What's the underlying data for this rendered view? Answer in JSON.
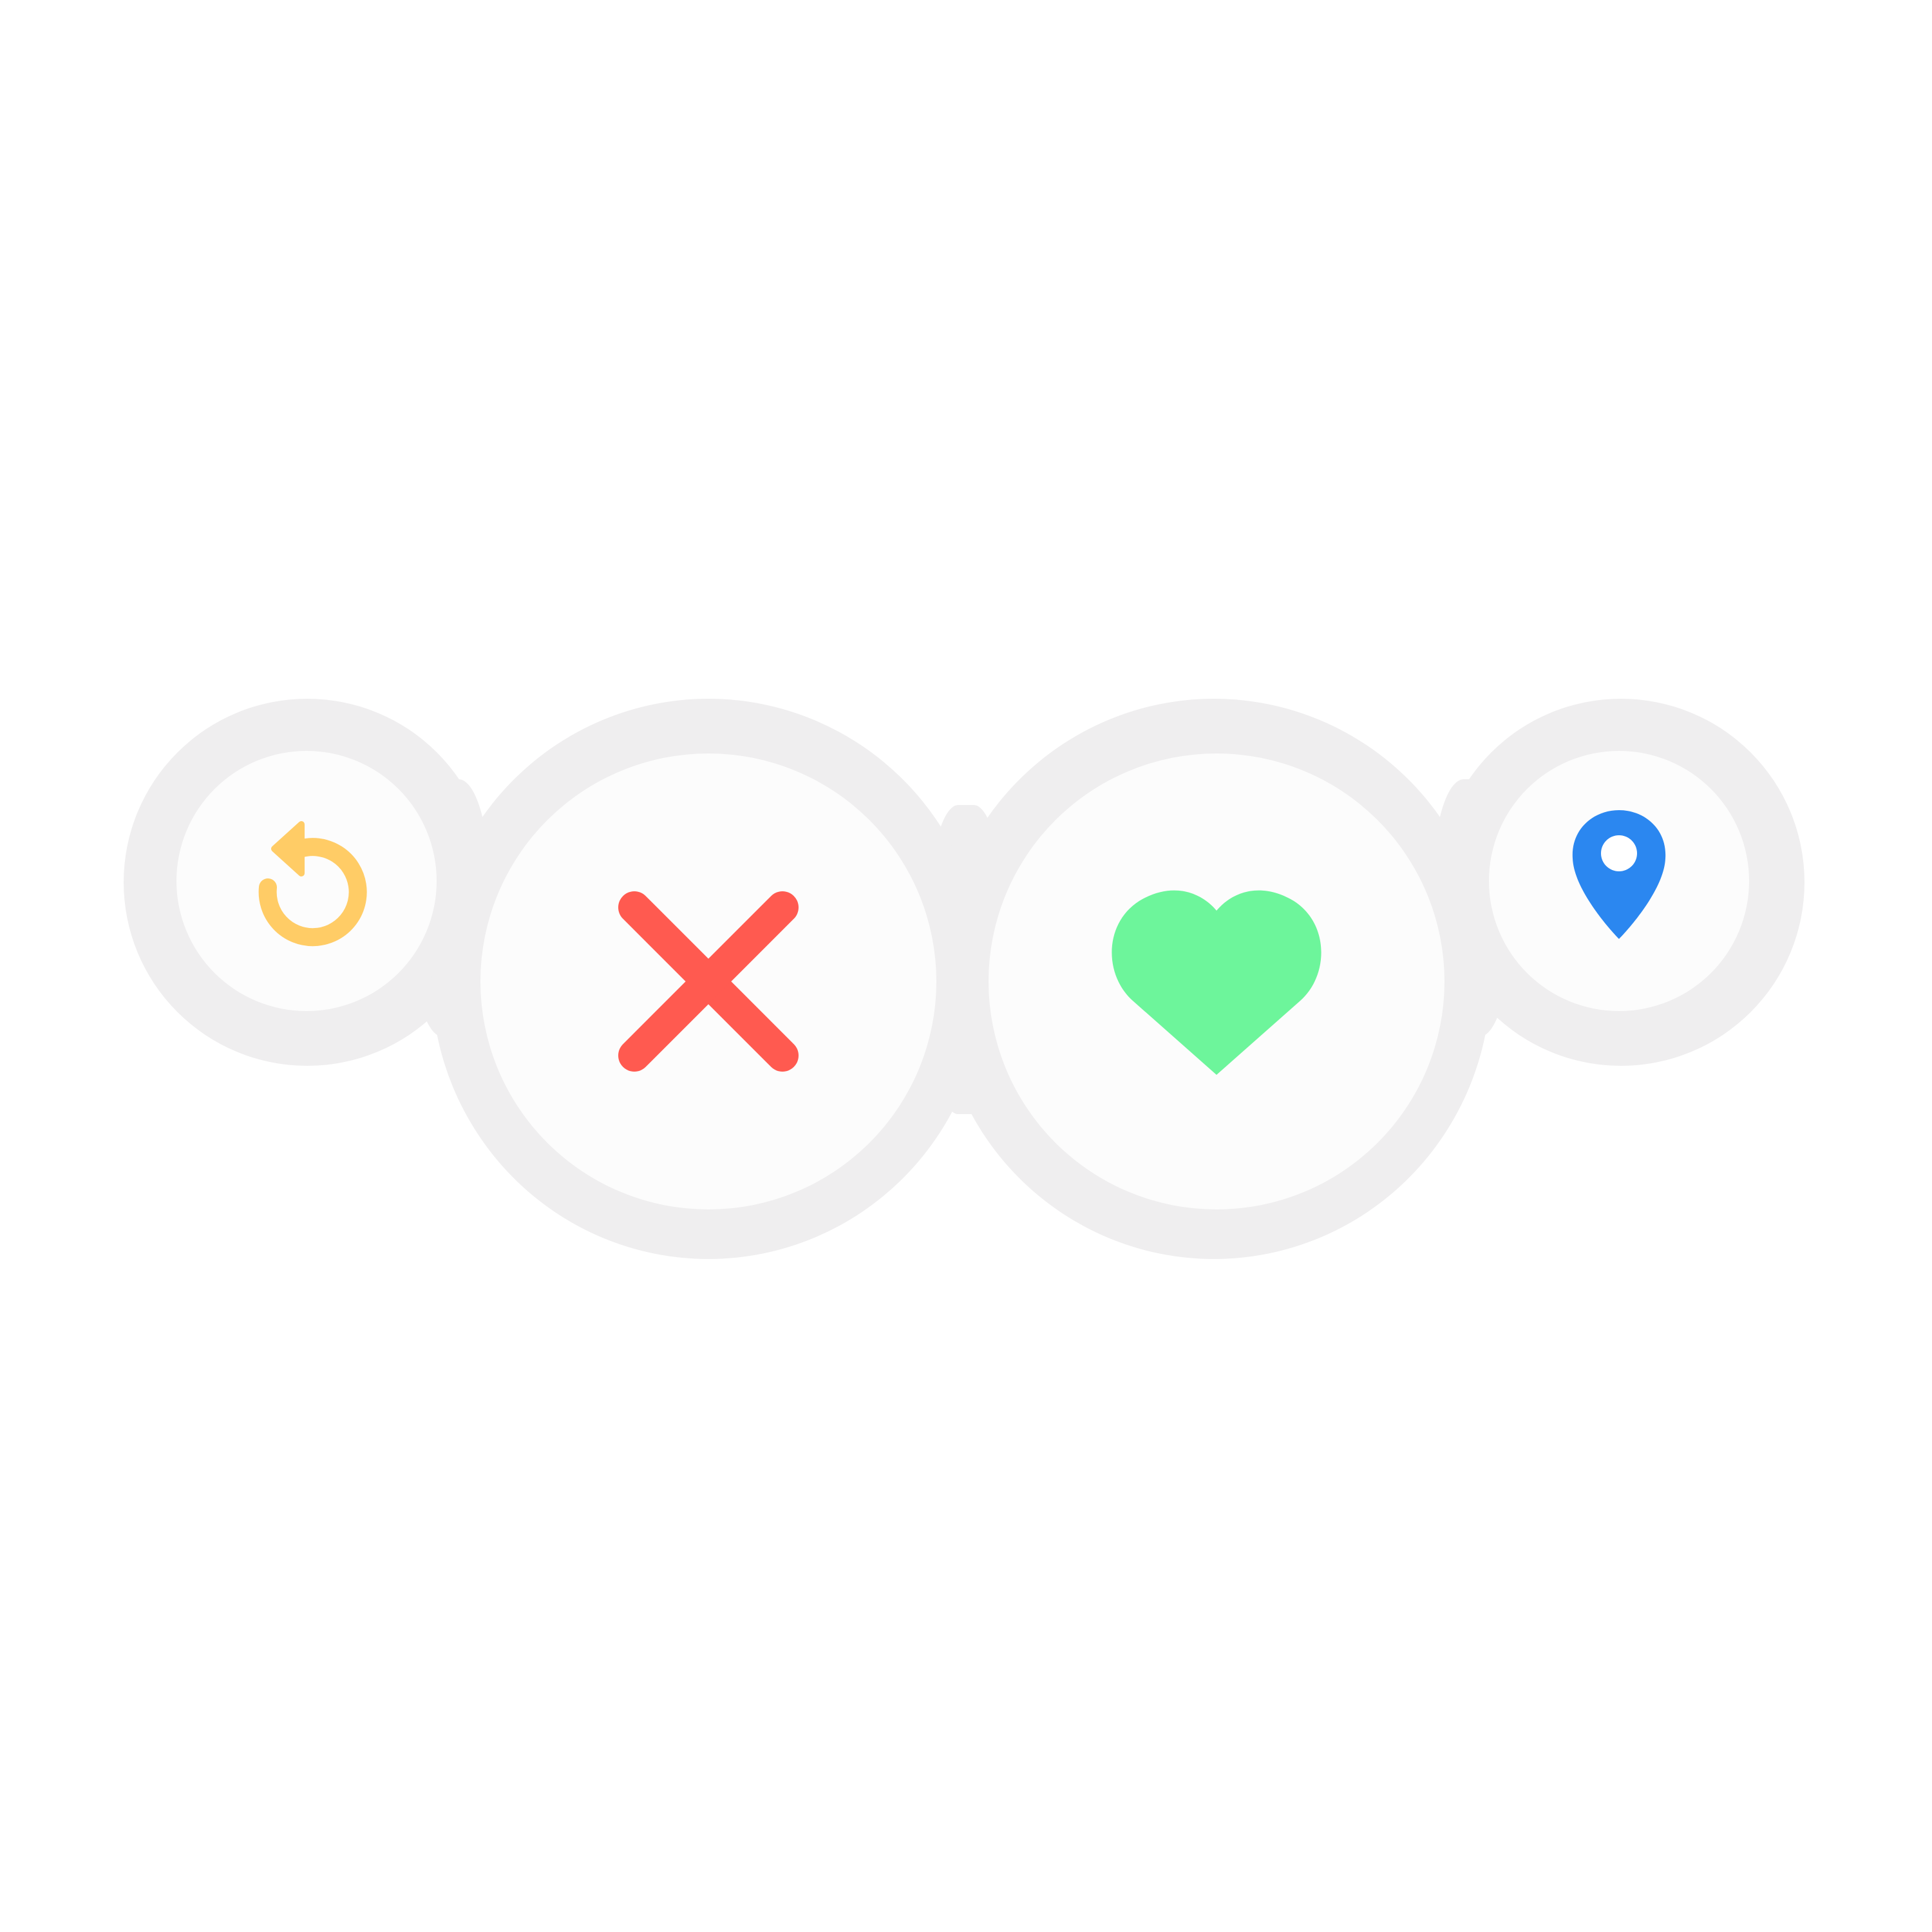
{
  "action_bar": {
    "buttons": [
      {
        "id": "rewind",
        "icon": "rewind-icon",
        "color": "#FFCC66"
      },
      {
        "id": "nope",
        "icon": "close-icon",
        "color": "#FF5A50"
      },
      {
        "id": "like",
        "icon": "heart-icon",
        "color": "#6DF59B"
      },
      {
        "id": "location",
        "icon": "location-pin-icon",
        "color": "#2B87F0"
      }
    ],
    "ring_color": "#EFEEEF",
    "button_fill": "#FCFCFC"
  }
}
